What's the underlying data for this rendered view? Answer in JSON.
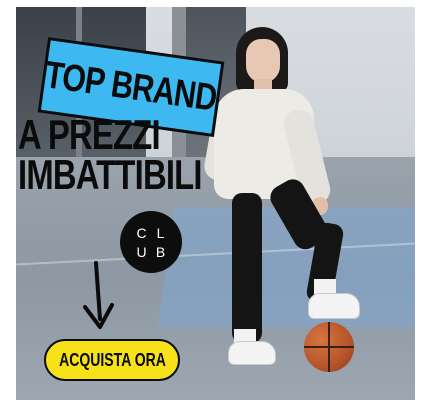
{
  "ad": {
    "badge_text": "TOP BRAND",
    "headline": [
      "A PREZZI",
      "IMBATTIBILI"
    ],
    "club_logo": [
      "C",
      "L",
      "U",
      "B"
    ],
    "cta_label": "ACQUISTA ORA",
    "arrow_icon": "arrow-down-icon",
    "colors": {
      "badge": "#3db8f0",
      "cta": "#f7e21a",
      "text": "#0b0b0b"
    }
  }
}
